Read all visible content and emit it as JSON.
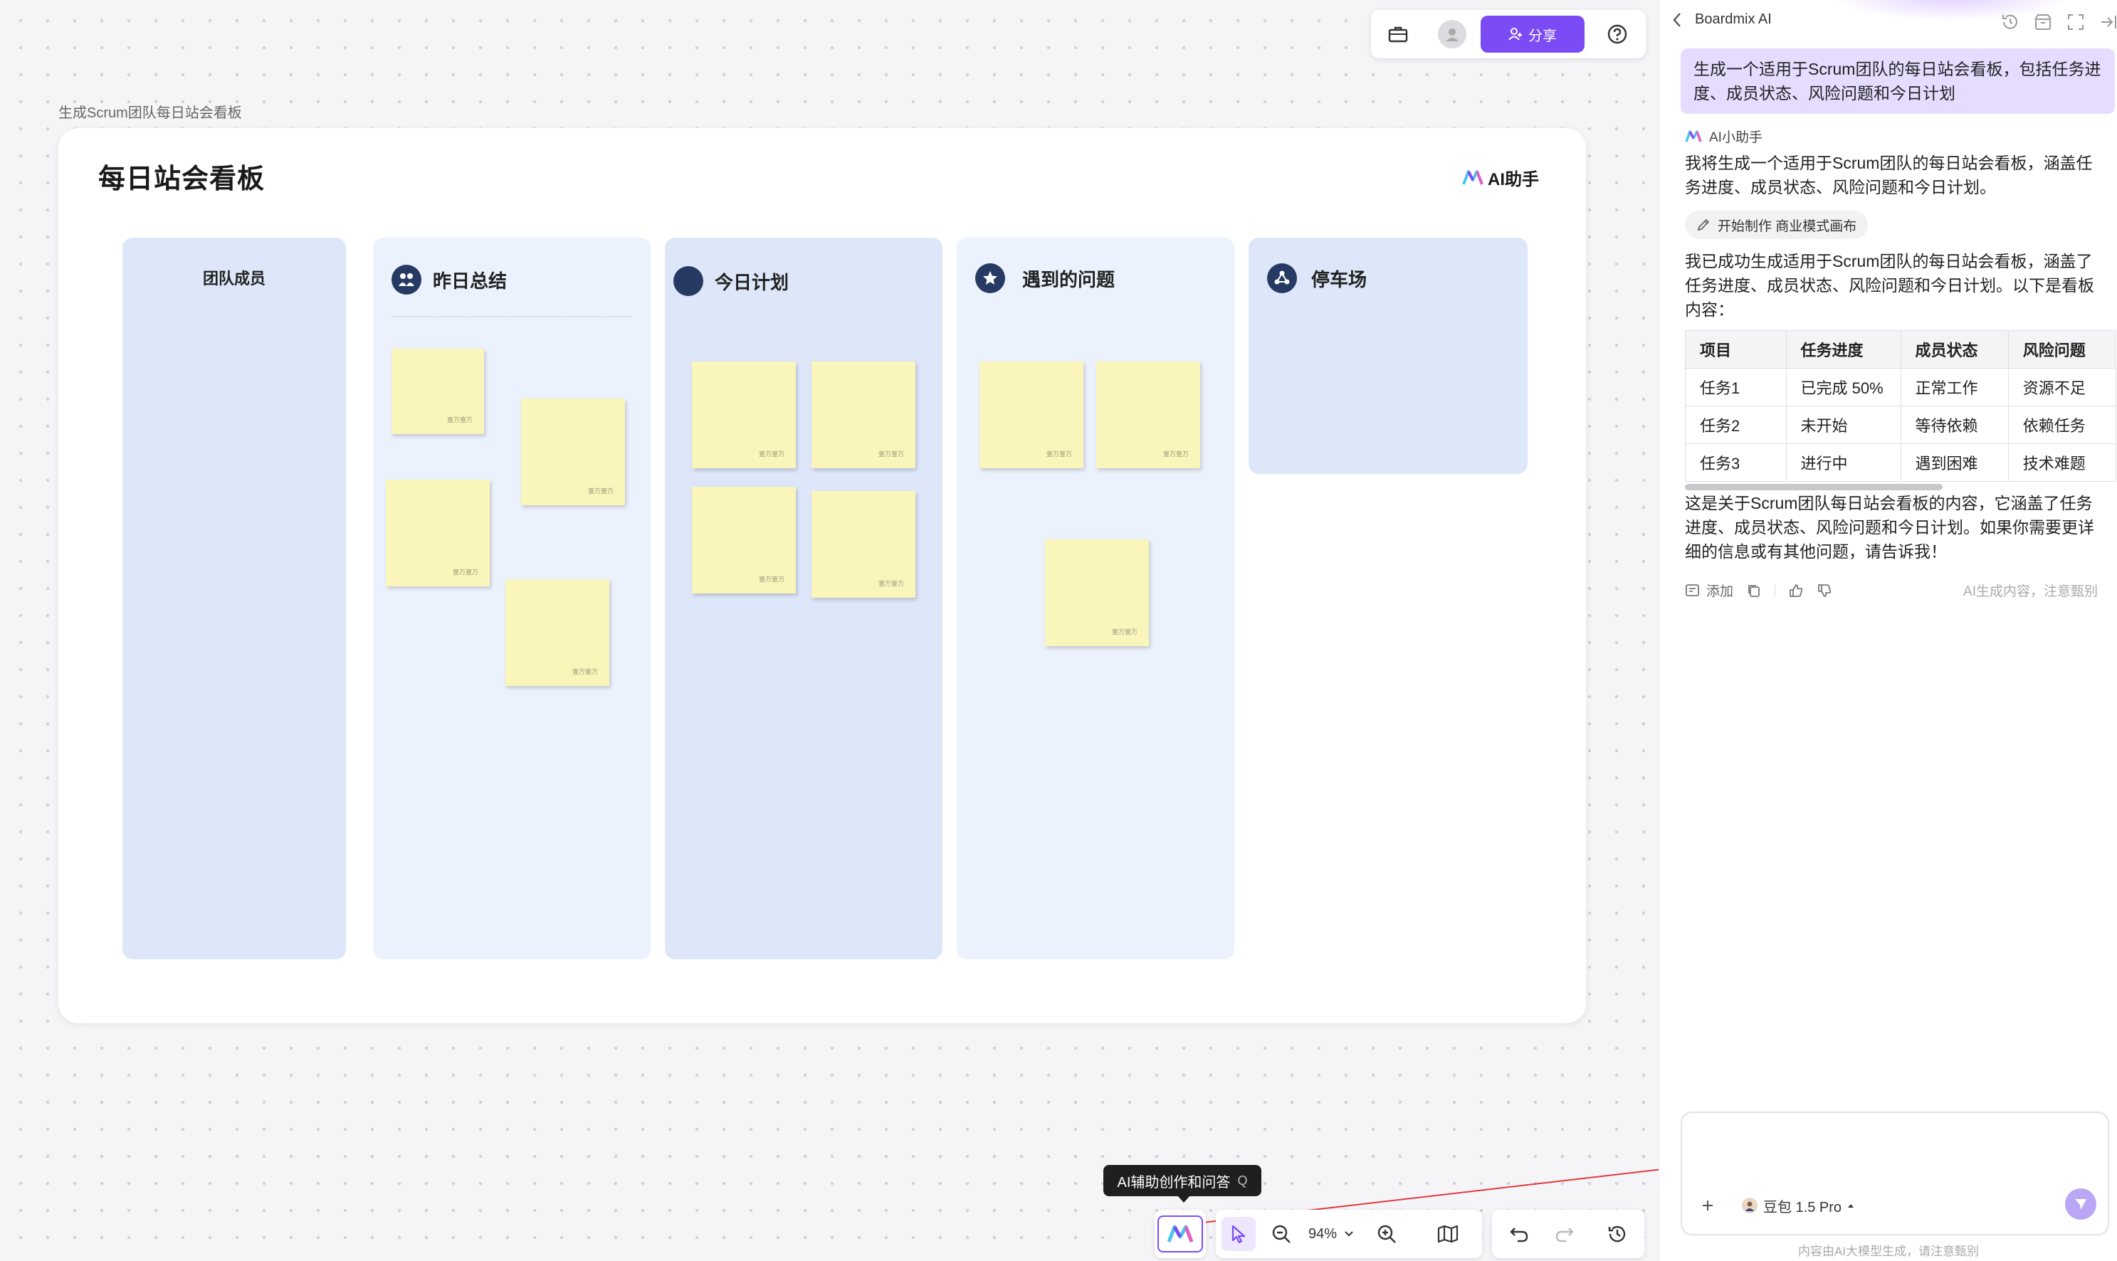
{
  "canvas": {
    "frame_label": "生成Scrum团队每日站会看板",
    "board_title": "每日站会看板",
    "ai_badge": "AI助手",
    "note_text": "壹万壹万",
    "columns": [
      {
        "title": "团队成员",
        "icon": "none"
      },
      {
        "title": "昨日总结",
        "icon": "people-icon"
      },
      {
        "title": "今日计划",
        "icon": "circle-icon"
      },
      {
        "title": "遇到的问题",
        "icon": "star-icon"
      },
      {
        "title": "停车场",
        "icon": "network-icon"
      }
    ]
  },
  "top_toolbar": {
    "share_label": "分享"
  },
  "bottom_toolbar": {
    "tooltip_label": "AI辅助创作和问答",
    "tooltip_key": "Q",
    "zoom": "94%"
  },
  "panel": {
    "title": "Boardmix AI",
    "user_message": "生成一个适用于Scrum团队的每日站会看板，包括任务进度、成员状态、风险问题和今日计划",
    "assistant_name": "AI小助手",
    "reply_intro": "我将生成一个适用于Scrum团队的每日站会看板，涵盖任务进度、成员状态、风险问题和今日计划。",
    "chip_label": "开始制作 商业模式画布",
    "reply_success": "我已成功生成适用于Scrum团队的每日站会看板，涵盖了任务进度、成员状态、风险问题和今日计划。以下是看板内容：",
    "table": {
      "headers": [
        "项目",
        "任务进度",
        "成员状态",
        "风险问题"
      ],
      "rows": [
        [
          "任务1",
          "已完成 50%",
          "正常工作",
          "资源不足"
        ],
        [
          "任务2",
          "未开始",
          "等待依赖",
          "依赖任务"
        ],
        [
          "任务3",
          "进行中",
          "遇到困难",
          "技术难题"
        ]
      ]
    },
    "reply_outro": "这是关于Scrum团队每日站会看板的内容，它涵盖了任务进度、成员状态、风险问题和今日计划。如果你需要更详细的信息或有其他问题，请告诉我！",
    "add_label": "添加",
    "disclaimer": "AI生成内容，注意甄别",
    "model_name": "豆包 1.5 Pro",
    "footer": "内容由AI大模型生成，请注意甄别"
  },
  "colors": {
    "accent": "#7b4cf5",
    "sticky": "#faf5bb",
    "column_dark": "#dde7f9",
    "column_light": "#ecf2fd",
    "icon_navy": "#263a63"
  }
}
